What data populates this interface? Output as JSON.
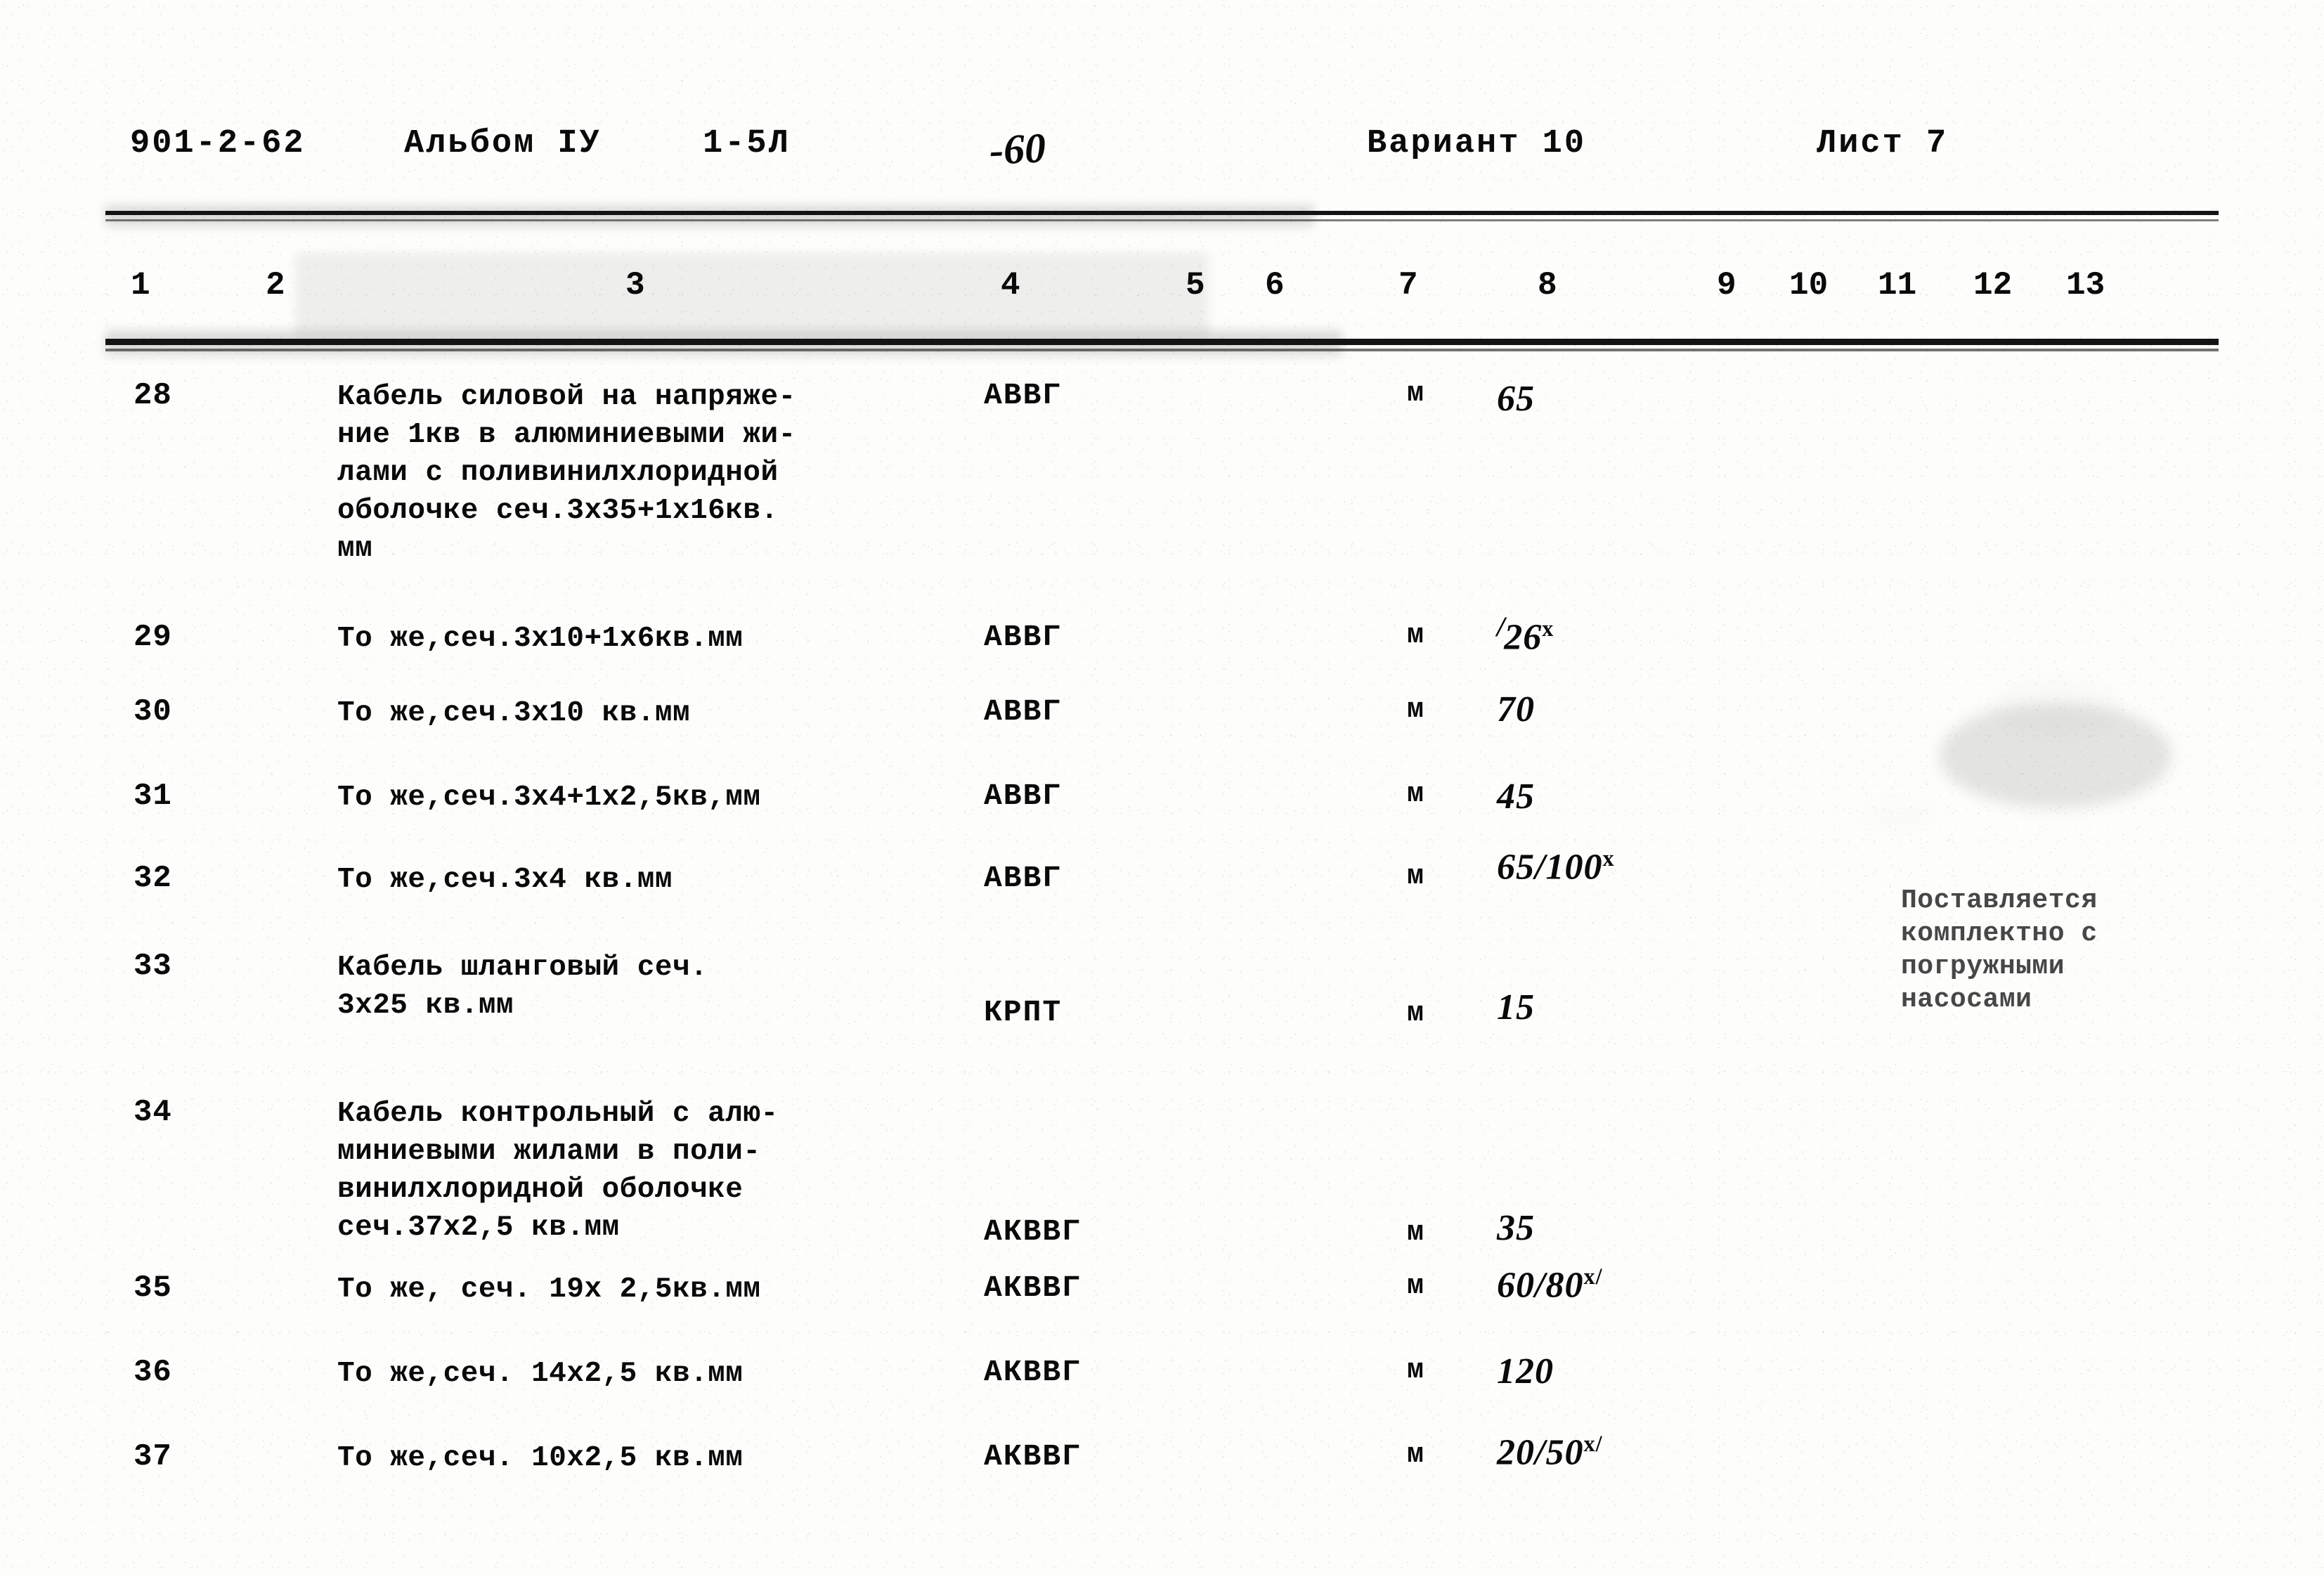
{
  "header": {
    "code": "901-2-62",
    "album": "Альбом IУ",
    "sheet_code": "1-5Л",
    "handwritten_mark": "-60",
    "variant": "Вариант 10",
    "list": "Лист 7"
  },
  "column_numbers": [
    "1",
    "2",
    "3",
    "4",
    "5",
    "6",
    "7",
    "8",
    "9",
    "10",
    "11",
    "12",
    "13"
  ],
  "side_note": "Поставляется\nкомплектно с\nпогружными\nнасосами",
  "rows": [
    {
      "num": "28",
      "name": "Кабель силовой на напряже-\nние 1кв в алюминиевыми жи-\nлами с поливинилхлоридной\nоболочке сеч.3х35+1х16кв.\nмм",
      "mark": "АВВГ",
      "unit": "м",
      "qty": "65",
      "qty_sup": "",
      "qty_lead": ""
    },
    {
      "num": "29",
      "name": "То же,сеч.3х10+1х6кв.мм",
      "mark": "АВВГ",
      "unit": "м",
      "qty": "26",
      "qty_sup": "х",
      "qty_lead": "/"
    },
    {
      "num": "30",
      "name": "То же,сеч.3х10 кв.мм",
      "mark": "АВВГ",
      "unit": "м",
      "qty": "70",
      "qty_sup": "",
      "qty_lead": ""
    },
    {
      "num": "31",
      "name": "То же,сеч.3х4+1х2,5кв,мм",
      "mark": "АВВГ",
      "unit": "м",
      "qty": "45",
      "qty_sup": "",
      "qty_lead": ""
    },
    {
      "num": "32",
      "name": "То же,сеч.3х4 кв.мм",
      "mark": "АВВГ",
      "unit": "м",
      "qty": "65/100",
      "qty_sup": "х",
      "qty_lead": ""
    },
    {
      "num": "33",
      "name": "Кабель шланговый сеч.\n3х25 кв.мм",
      "mark": "КРПТ",
      "unit": "м",
      "qty": "15",
      "qty_sup": "",
      "qty_lead": ""
    },
    {
      "num": "34",
      "name": "Кабель контрольный с алю-\nминиевыми жилами в поли-\nвинилхлоридной оболочке\nсеч.37х2,5 кв.мм",
      "mark": "АКВВГ",
      "unit": "м",
      "qty": "35",
      "qty_sup": "",
      "qty_lead": ""
    },
    {
      "num": "35",
      "name": "То же, сеч. 19х 2,5кв.мм",
      "mark": "АКВВГ",
      "unit": "м",
      "qty": "60/80",
      "qty_sup": "х/",
      "qty_lead": ""
    },
    {
      "num": "36",
      "name": "То же,сеч.  14х2,5 кв.мм",
      "mark": "АКВВГ",
      "unit": "м",
      "qty": "120",
      "qty_sup": "",
      "qty_lead": ""
    },
    {
      "num": "37",
      "name": "То же,сеч.  10х2,5 кв.мм",
      "mark": "АКВВГ",
      "unit": "м",
      "qty": "20/50",
      "qty_sup": "х/",
      "qty_lead": ""
    }
  ]
}
